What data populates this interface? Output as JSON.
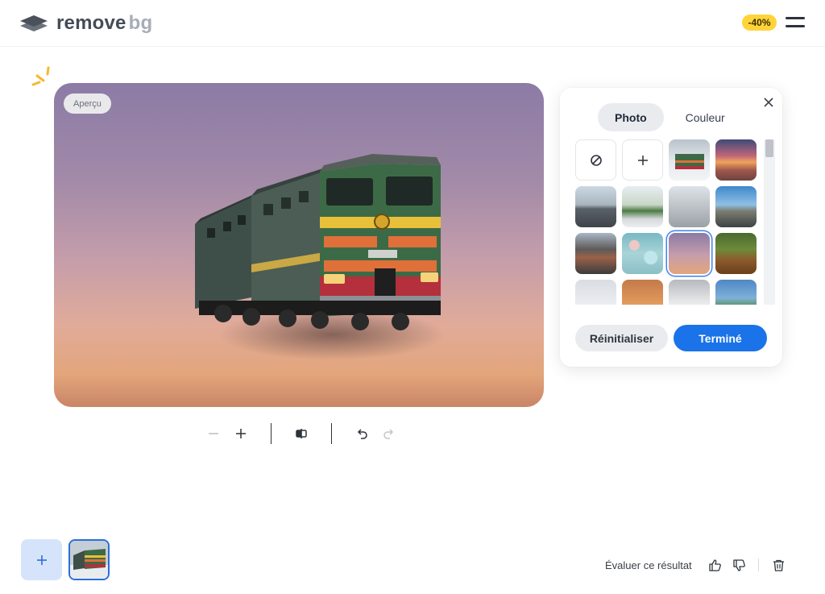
{
  "header": {
    "logo_text_1": "remove",
    "logo_text_2": "bg",
    "discount_badge": "-40%",
    "logo_icon": "stacked-layers-icon",
    "menu_icon": "hamburger-menu-icon"
  },
  "preview": {
    "badge": "Aperçu"
  },
  "toolbar": {
    "icons": [
      "zoom-out-icon",
      "zoom-in-icon",
      "compare-icon",
      "undo-icon",
      "redo-icon"
    ]
  },
  "panel": {
    "tabs": [
      {
        "label": "Photo",
        "active": true
      },
      {
        "label": "Couleur",
        "active": false
      }
    ],
    "reset_label": "Réinitialiser",
    "done_label": "Terminé",
    "selected_index": 6
  },
  "footer": {
    "rate_label": "Évaluer ce résultat"
  },
  "colors": {
    "accent": "#1a73e8",
    "badge_yellow": "#ffd43b",
    "selection": "#3b82f6"
  }
}
